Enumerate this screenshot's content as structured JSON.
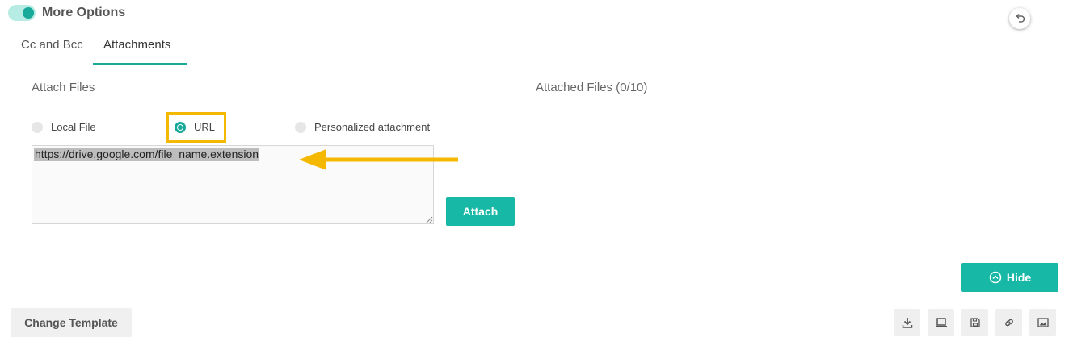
{
  "header": {
    "more_options_label": "More Options",
    "toggle_on": true,
    "undo_icon": "undo-icon"
  },
  "tabs": [
    {
      "label": "Cc and Bcc",
      "active": false
    },
    {
      "label": "Attachments",
      "active": true
    }
  ],
  "attach_files": {
    "title": "Attach Files",
    "options": [
      {
        "label": "Local File",
        "selected": false
      },
      {
        "label": "URL",
        "selected": true
      },
      {
        "label": "Personalized attachment",
        "selected": false
      }
    ],
    "url_value": "https://drive.google.com/file_name.extension",
    "attach_button": "Attach"
  },
  "attached_files": {
    "title": "Attached Files (0/10)"
  },
  "footer": {
    "hide_button": "Hide",
    "change_template_button": "Change Template",
    "tools": [
      "download-icon",
      "laptop-icon",
      "save-icon",
      "link-icon",
      "image-icon"
    ]
  },
  "colors": {
    "accent": "#17b8a6",
    "highlight": "#f5b800"
  }
}
